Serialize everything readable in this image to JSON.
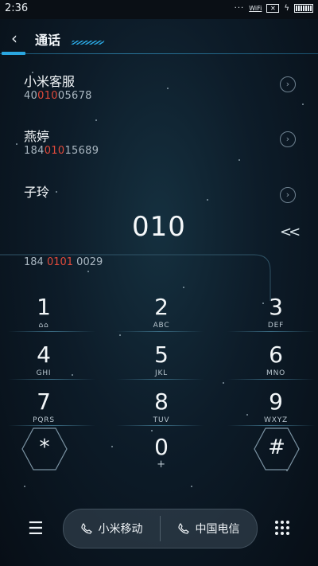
{
  "status_bar": {
    "time": "2:36",
    "wifi_label": "WiFi",
    "icons": [
      "dots-icon",
      "wifi-icon",
      "sim-off-icon",
      "charging-icon",
      "battery-icon"
    ]
  },
  "header": {
    "title": "通话",
    "back_icon": "chevron-left-icon"
  },
  "contacts": [
    {
      "name": "小米客服",
      "number_pre": "40",
      "number_hl": "010",
      "number_post": "05678"
    },
    {
      "name": "燕婷",
      "number_pre": "184",
      "number_hl": "010",
      "number_post": "15689"
    },
    {
      "name": "子玲",
      "number_pre": "",
      "number_hl": "",
      "number_post": ""
    }
  ],
  "input": {
    "dialed": "010",
    "delete_icon": "backspace-icon"
  },
  "suggestion": {
    "pre": "184 ",
    "hl": "0101",
    "post": " 0029"
  },
  "keypad": [
    {
      "digit": "1",
      "letters": ""
    },
    {
      "digit": "2",
      "letters": "ABC"
    },
    {
      "digit": "3",
      "letters": "DEF"
    },
    {
      "digit": "4",
      "letters": "GHI"
    },
    {
      "digit": "5",
      "letters": "JKL"
    },
    {
      "digit": "6",
      "letters": "MNO"
    },
    {
      "digit": "7",
      "letters": "PQRS"
    },
    {
      "digit": "8",
      "letters": "TUV"
    },
    {
      "digit": "9",
      "letters": "WXYZ"
    },
    {
      "digit": "*",
      "letters": ""
    },
    {
      "digit": "0",
      "letters": "+"
    },
    {
      "digit": "#",
      "letters": ""
    }
  ],
  "bottom_bar": {
    "menu_icon": "menu-icon",
    "sim1_label": "小米移动",
    "sim2_label": "中国电信",
    "keypad_icon": "dialpad-grid-icon"
  },
  "colors": {
    "accent": "#2aa6e0",
    "highlight": "#e24a3b"
  }
}
